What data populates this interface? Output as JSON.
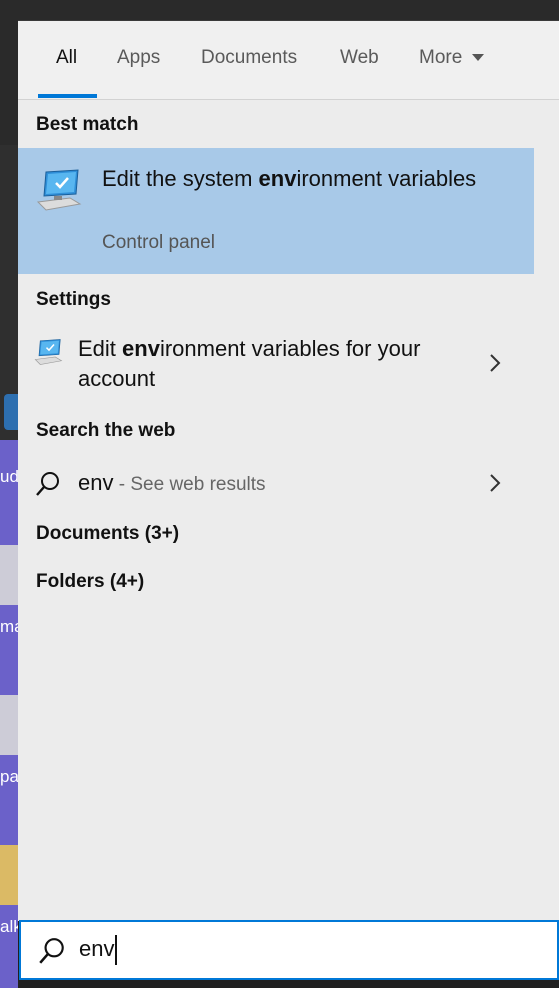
{
  "tabs": [
    {
      "label": "All"
    },
    {
      "label": "Apps"
    },
    {
      "label": "Documents"
    },
    {
      "label": "Web"
    },
    {
      "label": "More"
    }
  ],
  "best_match": {
    "heading": "Best match",
    "title_pre": "Edit the system ",
    "title_bold": "env",
    "title_post": "ironment variables",
    "subtitle": "Control panel",
    "icon": "monitor-settings-icon"
  },
  "settings": {
    "heading": "Settings",
    "title_pre": "Edit ",
    "title_bold": "env",
    "title_post": "ironment variables for your account",
    "icon": "monitor-settings-icon"
  },
  "web": {
    "heading": "Search the web",
    "query": "env",
    "hint": " - See web results",
    "icon": "search-icon"
  },
  "documents": {
    "heading": "Documents (3+)"
  },
  "folders": {
    "heading": "Folders (4+)"
  },
  "search": {
    "value": "env",
    "icon": "search-icon"
  },
  "desktop_fragments": [
    "ud",
    "ma",
    "pa",
    "alk"
  ],
  "colors": {
    "accent": "#0078d7",
    "selected": "#a8c9e8",
    "panel": "#ececec"
  }
}
